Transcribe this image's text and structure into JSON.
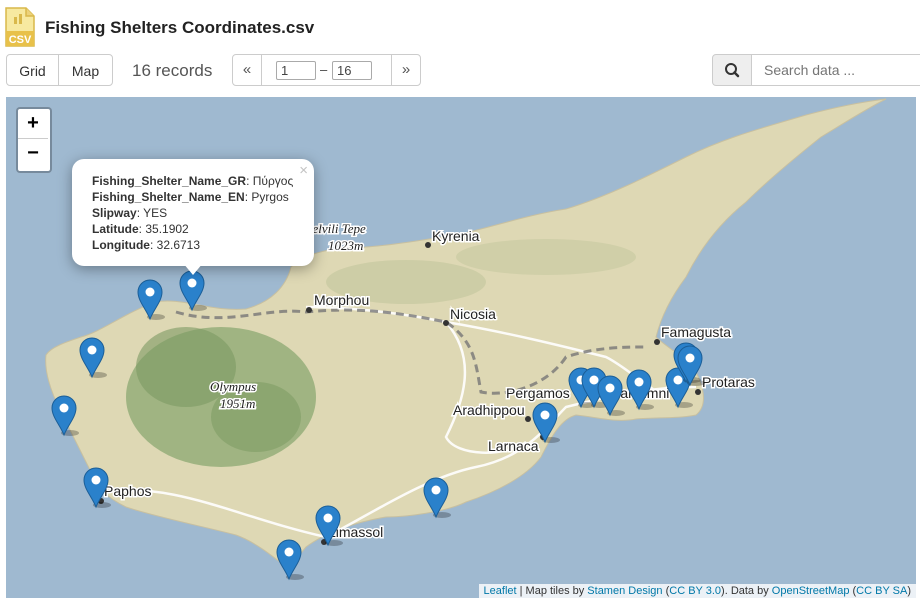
{
  "file": {
    "title": "Fishing Shelters Coordinates.csv",
    "icon": "csv-file-icon",
    "icon_text": "CSV"
  },
  "toolbar": {
    "grid_label": "Grid",
    "map_label": "Map",
    "records_text": "16 records",
    "pager_prev": "«",
    "pager_next": "»",
    "pager_from": "1",
    "pager_dash": "–",
    "pager_to": "16",
    "search_placeholder": "Search data ..."
  },
  "map": {
    "zoom_in": "+",
    "zoom_out": "−",
    "labels": {
      "kyrenia": "Kyrenia",
      "morphou": "Morphou",
      "nicosia": "Nicosia",
      "famagusta": "Famagusta",
      "protaras": "Protaras",
      "pergamos": "Pergamos",
      "aradhippou": "Aradhippou",
      "larnaca": "Larnaca",
      "paphos": "Paphos",
      "limassol": "Limassol",
      "paralimni": "Paralimni",
      "peak1_name": "Selvili Tepe",
      "peak1_elev": "1023m",
      "peak2_name": "Olympus",
      "peak2_elev": "1951m"
    },
    "popup": {
      "close": "×",
      "rows": [
        {
          "key": "Fishing_Shelter_Name_GR",
          "value": "Πύργος"
        },
        {
          "key": "Fishing_Shelter_Name_EN",
          "value": "Pyrgos"
        },
        {
          "key": "Slipway",
          "value": "YES"
        },
        {
          "key": "Latitude",
          "value": "35.1902"
        },
        {
          "key": "Longitude",
          "value": "32.6713"
        }
      ]
    },
    "marker_count": 16,
    "marker_color": "#2a81cb",
    "attribution": {
      "leaflet": "Leaflet",
      "tiles_prefix": " | Map tiles by ",
      "stamen": "Stamen Design",
      "ccby": "CC BY 3.0",
      "data_prefix": ". Data by ",
      "osm": "OpenStreetMap",
      "ccbysa": "CC BY SA"
    }
  }
}
